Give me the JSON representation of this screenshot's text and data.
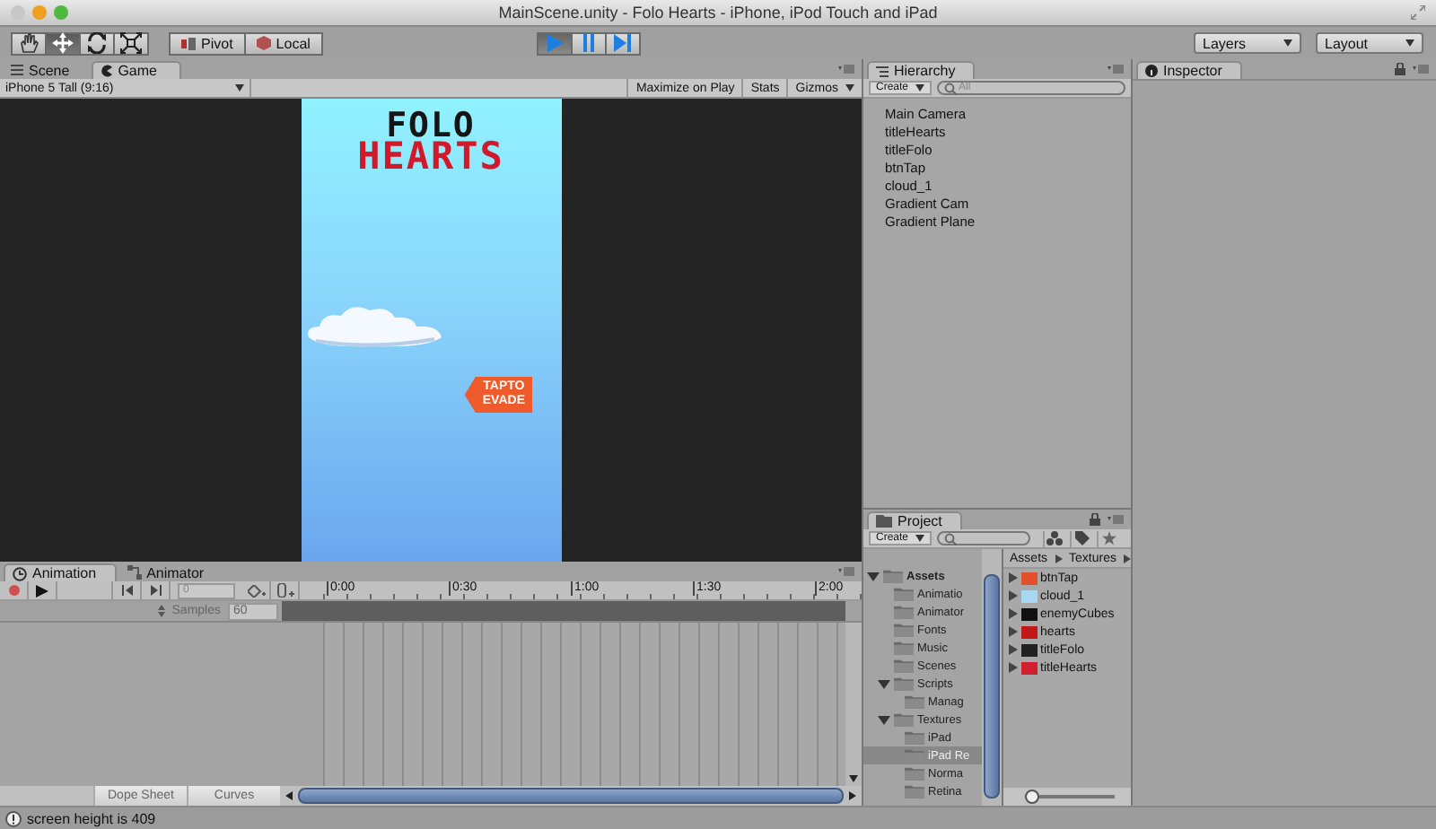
{
  "window": {
    "title": "MainScene.unity - Folo Hearts - iPhone, iPod Touch and iPad"
  },
  "toolbar": {
    "tools": [
      {
        "kind": "hand",
        "selected": false
      },
      {
        "kind": "move",
        "selected": true
      },
      {
        "kind": "rotate",
        "selected": false
      },
      {
        "kind": "scale",
        "selected": false
      }
    ],
    "pivot": "Pivot",
    "local": "Local",
    "playback": [
      {
        "kind": "play",
        "selected": true
      },
      {
        "kind": "pause",
        "selected": false
      },
      {
        "kind": "step",
        "selected": false
      }
    ],
    "layers": "Layers",
    "layout": "Layout"
  },
  "game_panel": {
    "tabs": [
      {
        "label": "Scene",
        "kind": "scene",
        "selected": false
      },
      {
        "label": "Game",
        "kind": "game",
        "selected": true
      }
    ],
    "aspect": "iPhone 5 Tall (9:16)",
    "buttons": [
      "Maximize on Play",
      "Stats",
      "Gizmos"
    ],
    "game": {
      "title_top": "FOLO",
      "title_bottom": "HEARTS",
      "button_lines": [
        "TAPTO",
        "EVADE"
      ]
    }
  },
  "hierarchy": {
    "tab": "Hierarchy",
    "create": "Create",
    "search_placeholder": "All",
    "items": [
      "Main Camera",
      "titleHearts",
      "titleFolo",
      "btnTap",
      "cloud_1",
      "Gradient Cam",
      "Gradient Plane"
    ]
  },
  "project": {
    "tab": "Project",
    "create": "Create",
    "folders": [
      {
        "name": "Assets",
        "expanded": true,
        "selected": false,
        "children": [
          {
            "name": "Animatio",
            "selected": false
          },
          {
            "name": "Animator",
            "selected": false
          },
          {
            "name": "Fonts",
            "selected": false
          },
          {
            "name": "Music",
            "selected": false
          },
          {
            "name": "Scenes",
            "selected": false
          },
          {
            "name": "Scripts",
            "expanded": true,
            "selected": false,
            "children": [
              {
                "name": "Manag",
                "selected": false
              }
            ]
          },
          {
            "name": "Textures",
            "expanded": true,
            "selected": false,
            "children": [
              {
                "name": "iPad",
                "selected": false
              },
              {
                "name": "iPad Re",
                "selected": true
              },
              {
                "name": "Norma",
                "selected": false
              },
              {
                "name": "Retina",
                "selected": false
              }
            ]
          }
        ]
      }
    ],
    "breadcrumb": [
      "Assets",
      "Textures"
    ],
    "icon_size": {
      "level": 0
    },
    "assets": [
      {
        "name": "btnTap",
        "color": "#e0502a"
      },
      {
        "name": "cloud_1",
        "color": "#a8d8f0"
      },
      {
        "name": "enemyCubes",
        "color": "#111111"
      },
      {
        "name": "hearts",
        "color": "#c01818"
      },
      {
        "name": "titleFolo",
        "color": "#222222"
      },
      {
        "name": "titleHearts",
        "color": "#d02030"
      }
    ]
  },
  "inspector": {
    "tab": "Inspector"
  },
  "animation": {
    "tabs": [
      {
        "label": "Animation",
        "kind": "clock",
        "selected": true
      },
      {
        "label": "Animator",
        "kind": "nodes",
        "selected": false
      }
    ],
    "frame": "0",
    "samples_label": "Samples",
    "samples": "60",
    "ticks": [
      "0:00",
      "0:30",
      "1:00",
      "1:30",
      "2:00"
    ],
    "modes": [
      {
        "label": "Dope Sheet",
        "selected": false
      },
      {
        "label": "Curves",
        "selected": false
      }
    ]
  },
  "status": "screen height is 409"
}
